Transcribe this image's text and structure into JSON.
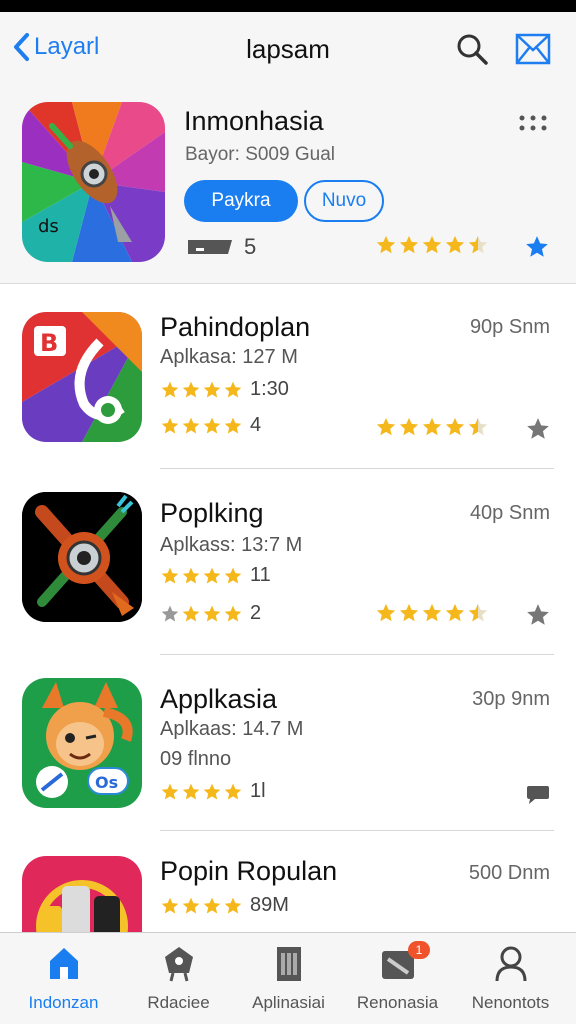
{
  "nav": {
    "back_label": "Layarl",
    "title": "lapsam"
  },
  "featured": {
    "name": "Inmonhasia",
    "subtitle": "Bayor: S009 Gual",
    "primary_button": "Paykra",
    "secondary_button": "Nuvo",
    "count": "5",
    "rating": 4.5
  },
  "apps": [
    {
      "name": "Pahindoplan",
      "meta": "Aplkasa: 127 M",
      "size": "90p Snm",
      "stars1": 4,
      "count1": "1:30",
      "stars2": 4,
      "count2": "4",
      "rating": 4.5,
      "action_icon": "star-icon"
    },
    {
      "name": "Poplking",
      "meta": "Aplkass: 13:7 M",
      "size": "40p Snm",
      "stars1": 4,
      "count1": "11",
      "stars2": 4,
      "count2": "2",
      "rating": 4.5,
      "action_icon": "star-icon"
    },
    {
      "name": "Applkasia",
      "meta": "Aplkaas: 14.7 M",
      "extra": "09 flnno",
      "size": "30p 9nm",
      "stars1": 4,
      "count1": "1l",
      "action_icon": "comment-icon"
    },
    {
      "name": "Popin Ropulan",
      "size": "500 Dnm",
      "stars1": 4,
      "count1": "89M"
    }
  ],
  "tabs": [
    {
      "label": "Indonzan",
      "icon": "home-icon",
      "active": true
    },
    {
      "label": "Rdaciee",
      "icon": "category-icon",
      "active": false
    },
    {
      "label": "Aplinasiai",
      "icon": "apps-icon",
      "active": false
    },
    {
      "label": "Renonasia",
      "icon": "updates-icon",
      "active": false,
      "badge": "1"
    },
    {
      "label": "Nenontots",
      "icon": "profile-icon",
      "active": false
    }
  ],
  "colors": {
    "accent": "#1a7ef0",
    "star": "#f5b81c",
    "badge": "#f0522b"
  }
}
